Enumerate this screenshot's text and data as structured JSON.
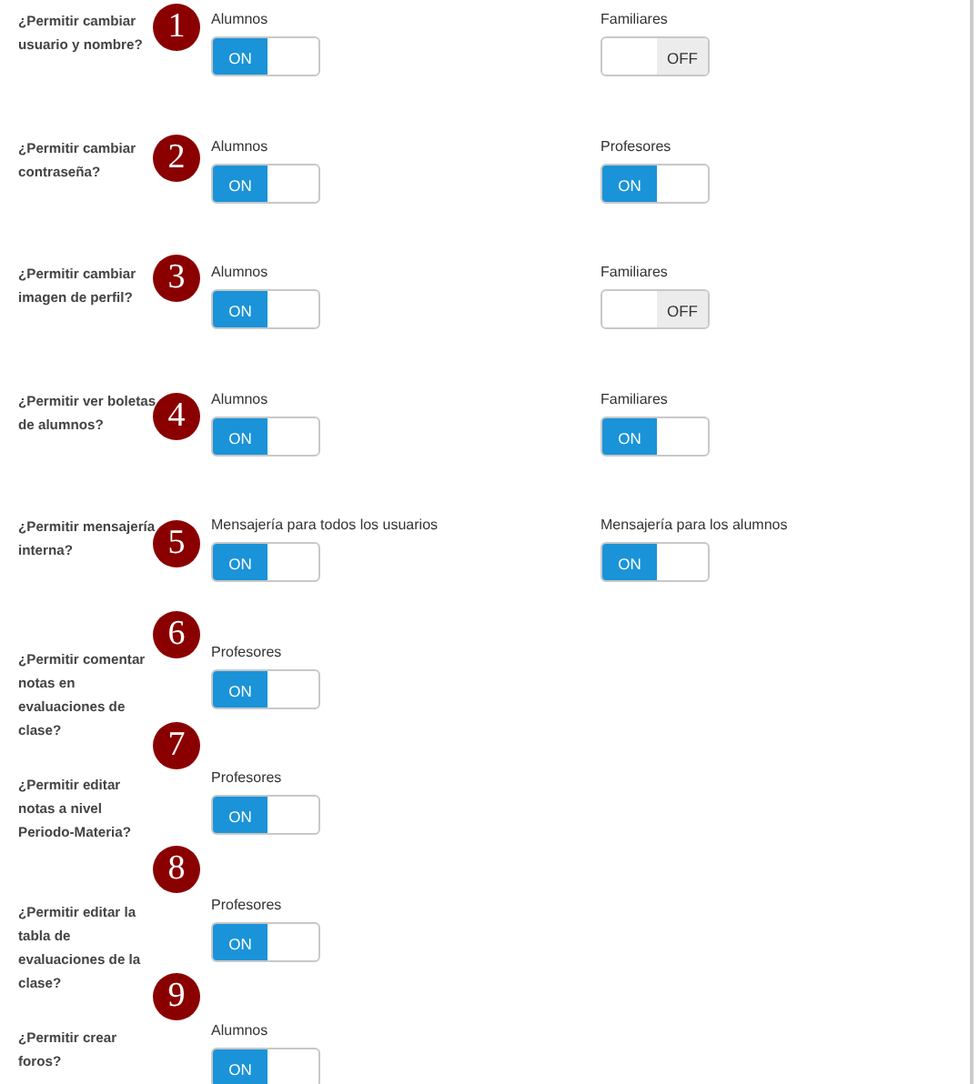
{
  "settings": [
    {
      "number": "1",
      "question": "¿Permitir cambiar usuario y nombre?",
      "options": [
        {
          "label": "Alumnos",
          "on": true,
          "toggle_text": "ON"
        },
        {
          "label": "Familiares",
          "on": false,
          "toggle_text": "OFF"
        }
      ]
    },
    {
      "number": "2",
      "question": "¿Permitir cambiar contraseña?",
      "options": [
        {
          "label": "Alumnos",
          "on": true,
          "toggle_text": "ON"
        },
        {
          "label": "Profesores",
          "on": true,
          "toggle_text": "ON"
        }
      ]
    },
    {
      "number": "3",
      "question": "¿Permitir cambiar imagen de perfil?",
      "options": [
        {
          "label": "Alumnos",
          "on": true,
          "toggle_text": "ON"
        },
        {
          "label": "Familiares",
          "on": false,
          "toggle_text": "OFF"
        }
      ]
    },
    {
      "number": "4",
      "question": "¿Permitir ver boletas de alumnos?",
      "options": [
        {
          "label": "Alumnos",
          "on": true,
          "toggle_text": "ON"
        },
        {
          "label": "Familiares",
          "on": true,
          "toggle_text": "ON"
        }
      ]
    },
    {
      "number": "5",
      "question": "¿Permitir mensajería interna?",
      "options": [
        {
          "label": "Mensajería para todos los usuarios",
          "on": true,
          "toggle_text": "ON"
        },
        {
          "label": "Mensajería para los alumnos",
          "on": true,
          "toggle_text": "ON"
        }
      ]
    },
    {
      "number": "6",
      "question": "¿Permitir comentar notas en evaluaciones de clase?",
      "options": [
        {
          "label": "Profesores",
          "on": true,
          "toggle_text": "ON"
        }
      ]
    },
    {
      "number": "7",
      "question": "¿Permitir editar notas a nivel Periodo-Materia?",
      "options": [
        {
          "label": "Profesores",
          "on": true,
          "toggle_text": "ON"
        }
      ]
    },
    {
      "number": "8",
      "question": "¿Permitir editar la tabla de evaluaciones de la clase?",
      "options": [
        {
          "label": "Profesores",
          "on": true,
          "toggle_text": "ON"
        }
      ]
    },
    {
      "number": "9",
      "question": "¿Permitir crear foros?",
      "options": [
        {
          "label": "Alumnos",
          "on": true,
          "toggle_text": "ON"
        }
      ]
    }
  ]
}
